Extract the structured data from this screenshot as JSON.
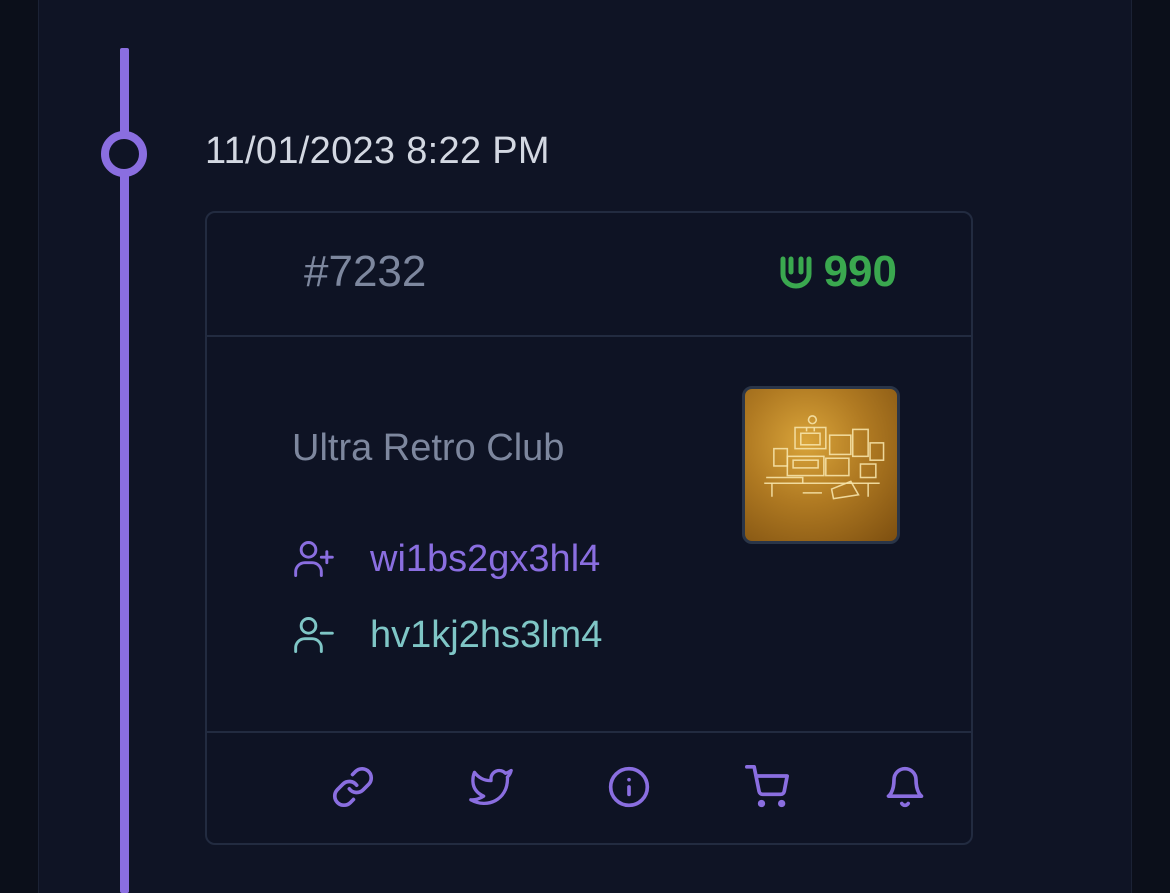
{
  "event": {
    "timestamp": "11/01/2023 8:22 PM"
  },
  "card": {
    "token_id": "#7232",
    "price": "990",
    "price_icon": "ultra-u-icon",
    "collection": "Ultra Retro Club",
    "buyer": "wi1bs2gx3hl4",
    "seller": "hv1kj2hs3lm4",
    "image_alt": "retro computer desk artwork",
    "actions": [
      "link-icon",
      "twitter-icon",
      "info-icon",
      "cart-icon",
      "bell-icon"
    ]
  },
  "colors": {
    "accent": "#8a6ee0",
    "price": "#3aa84f",
    "seller": "#7fc6c6",
    "muted": "#7d879e"
  }
}
